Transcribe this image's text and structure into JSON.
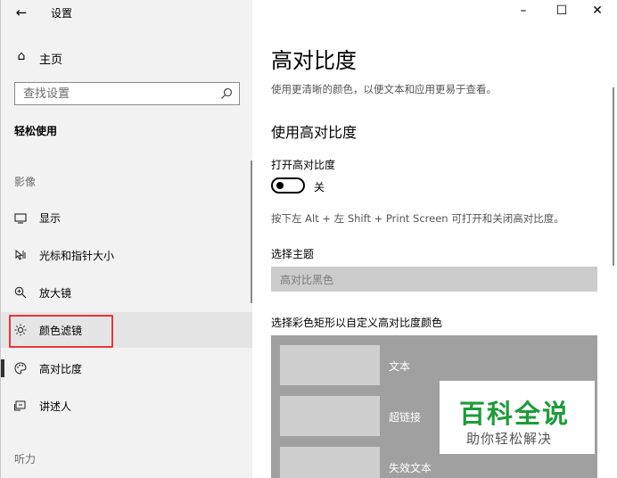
{
  "app": {
    "title": "设置",
    "back_icon": "arrow-left-icon"
  },
  "window_controls": {
    "minimize": "–",
    "maximize": "☐",
    "close": "✕"
  },
  "sidebar": {
    "home_label": "主页",
    "search_placeholder": "查找设置",
    "section_title": "轻松使用",
    "groups": [
      {
        "title": "影像",
        "items": [
          {
            "label": "显示",
            "icon": "monitor-icon"
          },
          {
            "label": "光标和指针大小",
            "icon": "pointer-icon"
          },
          {
            "label": "放大镜",
            "icon": "magnifier-icon"
          },
          {
            "label": "颜色滤镜",
            "icon": "brightness-icon",
            "highlighted": true
          },
          {
            "label": "高对比度",
            "icon": "palette-icon",
            "selected": true
          },
          {
            "label": "讲述人",
            "icon": "narrator-icon"
          }
        ]
      },
      {
        "title": "听力",
        "items": []
      }
    ]
  },
  "main": {
    "title": "高对比度",
    "description": "使用更清晰的颜色，以便文本和应用更易于查看。",
    "section_heading": "使用高对比度",
    "toggle": {
      "label": "打开高对比度",
      "state": "关",
      "on": false
    },
    "hint": "按下左 Alt + 左 Shift + Print Screen 可打开和关闭高对比度。",
    "theme": {
      "label": "选择主题",
      "selected": "高对比黑色"
    },
    "colors": {
      "label": "选择彩色矩形以自定义高对比度颜色",
      "items": [
        "文本",
        "超链接",
        "失效文本"
      ]
    }
  },
  "watermark": {
    "title": "百科全说",
    "subtitle": "助你轻松解决"
  }
}
